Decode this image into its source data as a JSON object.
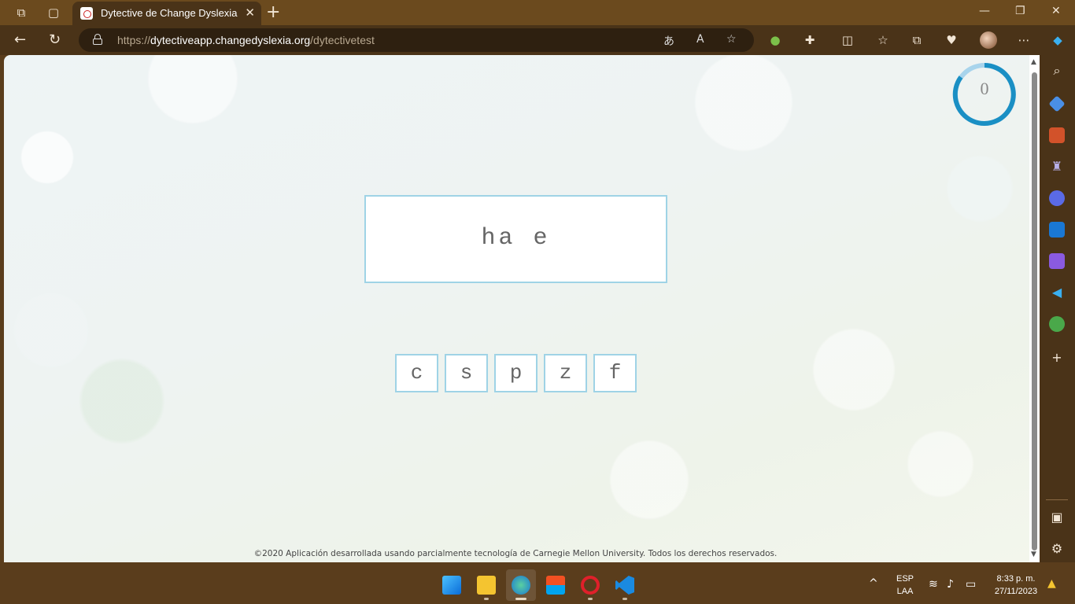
{
  "browser": {
    "tab_title": "Dytective de Change Dyslexia",
    "url_prefix": "https://",
    "url_host": "dytectiveapp.changedyslexia.org",
    "url_path": "/dytectivetest"
  },
  "game": {
    "score": "0",
    "word": "ha e",
    "options": [
      "c",
      "s",
      "p",
      "z",
      "f"
    ]
  },
  "footer": {
    "copyright": "©2020 Aplicación desarrollada usando parcialmente tecnología de Carnegie Mellon University. Todos los derechos reservados."
  },
  "taskbar": {
    "language": "ESP",
    "layout": "LAA",
    "time": "8:33 p. m.",
    "date": "27/11/2023"
  },
  "colors": {
    "accent_ring": "#1a8fc4",
    "box_border": "#9fd3e6",
    "browser_frame": "#6b4a1e"
  }
}
